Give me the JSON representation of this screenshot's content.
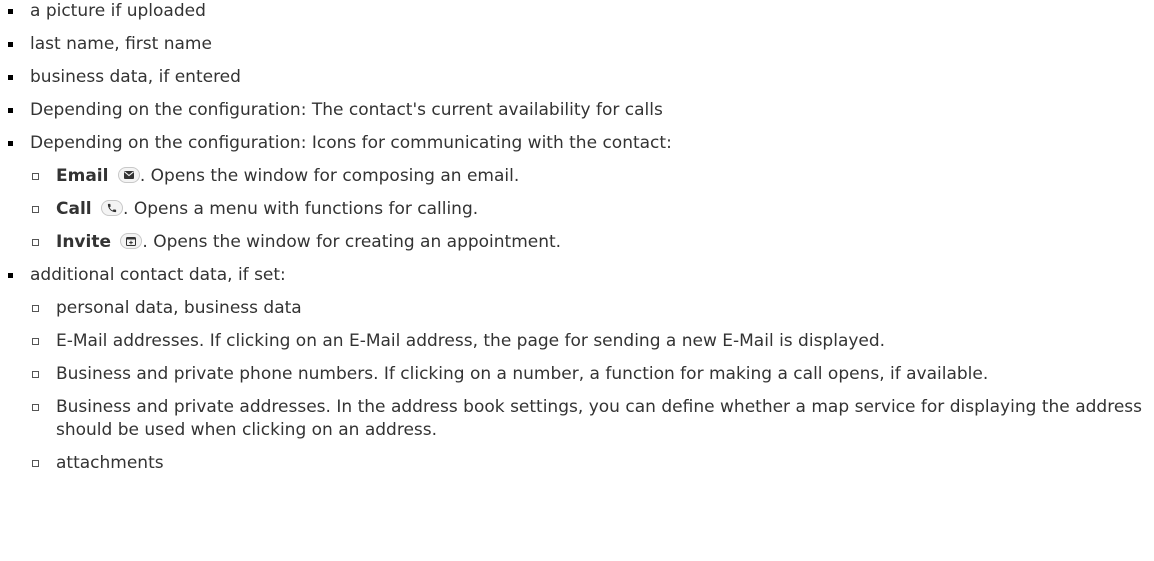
{
  "items": [
    {
      "text": "a picture if uploaded"
    },
    {
      "text": "last name, first name"
    },
    {
      "text": "business data, if entered"
    },
    {
      "text": "Depending on the configuration: The contact's current availability for calls"
    },
    {
      "text": "Depending on the configuration: Icons for communicating with the contact:",
      "subitems": [
        {
          "term": "Email",
          "icon": "envelope-icon",
          "desc": ". Opens the window for composing an email."
        },
        {
          "term": "Call",
          "icon": "phone-icon",
          "desc": ". Opens a menu with functions for calling."
        },
        {
          "term": "Invite",
          "icon": "calendar-icon",
          "desc": ". Opens the window for creating an appointment."
        }
      ]
    },
    {
      "text": "additional contact data, if set:",
      "subitems": [
        {
          "text": "personal data, business data"
        },
        {
          "text": "E-Mail addresses. If clicking on an E-Mail address, the page for sending a new E-Mail is displayed."
        },
        {
          "text": "Business and private phone numbers. If clicking on a number, a function for making a call opens, if available."
        },
        {
          "text": "Business and private addresses. In the address book settings, you can define whether a map service for displaying the address should be used when clicking on an address."
        },
        {
          "text": "attachments"
        }
      ]
    }
  ]
}
